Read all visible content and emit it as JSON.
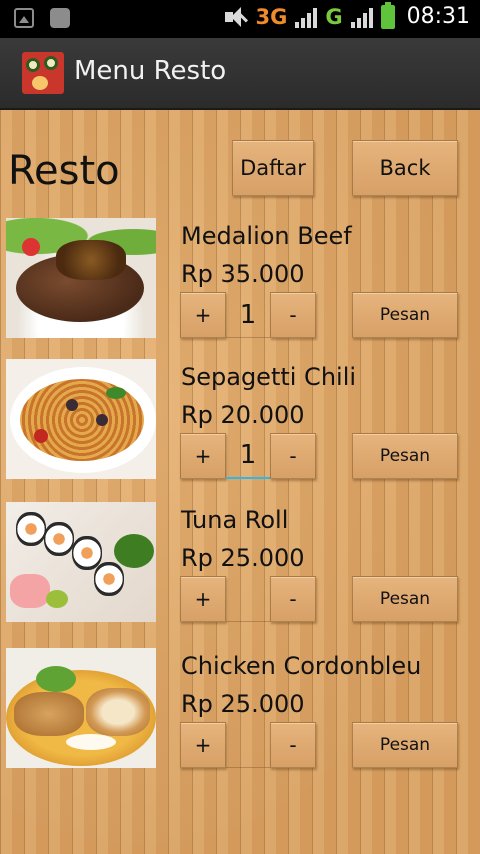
{
  "statusbar": {
    "network_1": "3G",
    "network_2": "G",
    "time": "08:31"
  },
  "actionbar": {
    "title": "Menu Resto"
  },
  "page": {
    "title": "Resto",
    "daftar_label": "Daftar",
    "back_label": "Back"
  },
  "items": [
    {
      "name": "Medalion Beef",
      "price": "Rp 35.000",
      "quantity": "1",
      "plus_label": "+",
      "minus_label": "-",
      "order_label": "Pesan",
      "image": "medalion-beef"
    },
    {
      "name": "Sepagetti Chili",
      "price": "Rp 20.000",
      "quantity": "1",
      "plus_label": "+",
      "minus_label": "-",
      "order_label": "Pesan",
      "image": "spaghetti-chili"
    },
    {
      "name": "Tuna Roll",
      "price": "Rp 25.000",
      "quantity": "",
      "plus_label": "+",
      "minus_label": "-",
      "order_label": "Pesan",
      "image": "tuna-roll"
    },
    {
      "name": "Chicken Cordonbleu",
      "price": "Rp 25.000",
      "quantity": "",
      "plus_label": "+",
      "minus_label": "-",
      "order_label": "Pesan",
      "image": "chicken-cordonbleu"
    }
  ],
  "colors": {
    "wood": "#d8a061",
    "actionbar": "#333333",
    "focus_underline": "#33b5e5"
  }
}
